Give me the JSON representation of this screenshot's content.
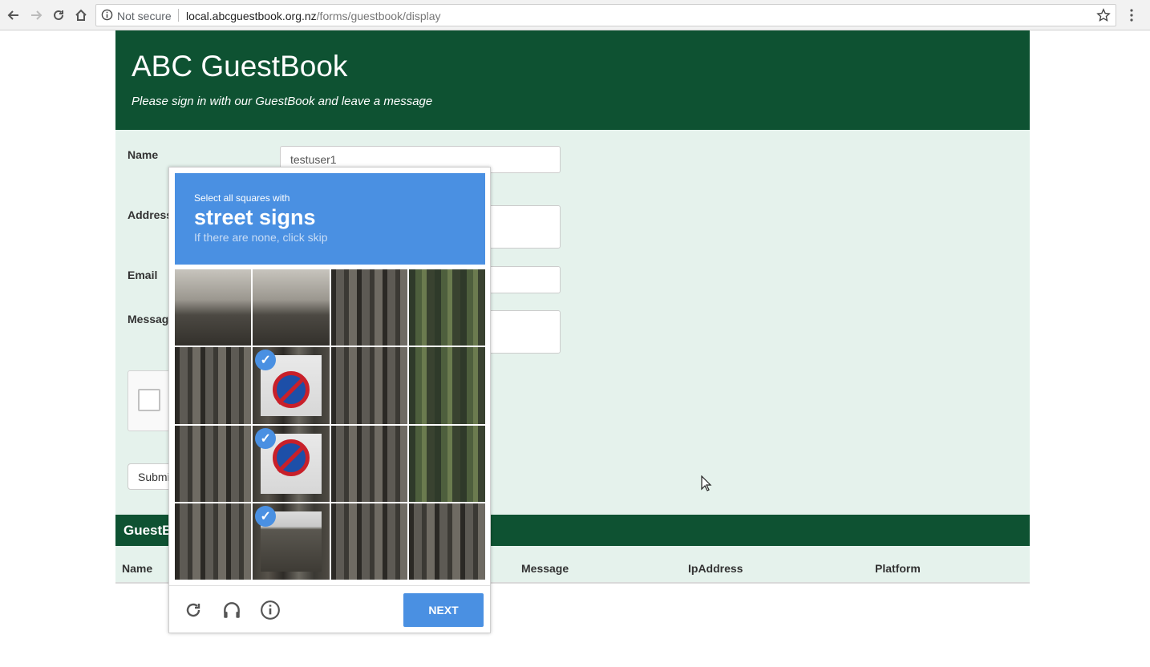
{
  "browser": {
    "security_label": "Not secure",
    "url_host": "local.abcguestbook.org.nz",
    "url_path": "/forms/guestbook/display"
  },
  "header": {
    "title": "ABC GuestBook",
    "subtitle": "Please sign in with our GuestBook and leave a message"
  },
  "form": {
    "name_label": "Name",
    "name_value": "testuser1",
    "address_label": "Address",
    "email_label": "Email",
    "message_label": "Message",
    "submit_label": "Submit"
  },
  "guestbook": {
    "title": "GuestBook",
    "columns": [
      "Name",
      "Message",
      "IpAddress",
      "Platform"
    ]
  },
  "captcha": {
    "instruction": "Select all squares with",
    "target": "street signs",
    "hint": "If there are none, click skip",
    "selected_tiles": [
      5,
      9,
      13
    ],
    "next_label": "NEXT",
    "accent_color": "#4a90e2"
  },
  "colors": {
    "header_bg": "#0e5232",
    "form_bg": "#e5f2ec"
  }
}
